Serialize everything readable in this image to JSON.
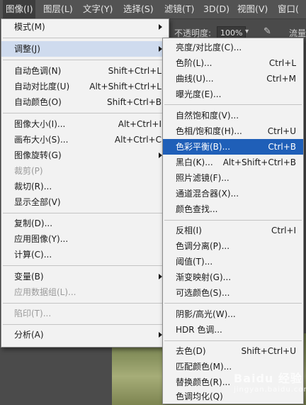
{
  "menubar": {
    "items": [
      {
        "label": "图像(I)"
      },
      {
        "label": "图层(L)"
      },
      {
        "label": "文字(Y)"
      },
      {
        "label": "选择(S)"
      },
      {
        "label": "滤镜(T)"
      },
      {
        "label": "3D(D)"
      },
      {
        "label": "视图(V)"
      },
      {
        "label": "窗口("
      }
    ]
  },
  "options_bar": {
    "opacity_label": "不透明度:",
    "opacity_value": "100%",
    "flow_label": "流量"
  },
  "image_menu": {
    "items": [
      {
        "label": "模式(M)",
        "submenu": true
      },
      {
        "label": "调整(J)",
        "submenu": true,
        "highlight": true
      },
      {
        "label": "自动色调(N)",
        "shortcut": "Shift+Ctrl+L"
      },
      {
        "label": "自动对比度(U)",
        "shortcut": "Alt+Shift+Ctrl+L"
      },
      {
        "label": "自动颜色(O)",
        "shortcut": "Shift+Ctrl+B"
      },
      {
        "label": "图像大小(I)...",
        "shortcut": "Alt+Ctrl+I"
      },
      {
        "label": "画布大小(S)...",
        "shortcut": "Alt+Ctrl+C"
      },
      {
        "label": "图像旋转(G)",
        "submenu": true
      },
      {
        "label": "裁剪(P)",
        "disabled": true
      },
      {
        "label": "裁切(R)..."
      },
      {
        "label": "显示全部(V)"
      },
      {
        "label": "复制(D)..."
      },
      {
        "label": "应用图像(Y)..."
      },
      {
        "label": "计算(C)..."
      },
      {
        "label": "变量(B)",
        "submenu": true
      },
      {
        "label": "应用数据组(L)...",
        "disabled": true
      },
      {
        "label": "陷印(T)...",
        "disabled": true
      },
      {
        "label": "分析(A)",
        "submenu": true
      }
    ]
  },
  "adjust_menu": {
    "items": [
      {
        "label": "亮度/对比度(C)..."
      },
      {
        "label": "色阶(L)...",
        "shortcut": "Ctrl+L"
      },
      {
        "label": "曲线(U)...",
        "shortcut": "Ctrl+M"
      },
      {
        "label": "曝光度(E)..."
      },
      {
        "label": "自然饱和度(V)..."
      },
      {
        "label": "色相/饱和度(H)...",
        "shortcut": "Ctrl+U"
      },
      {
        "label": "色彩平衡(B)...",
        "shortcut": "Ctrl+B",
        "highlight": true
      },
      {
        "label": "黑白(K)...",
        "shortcut": "Alt+Shift+Ctrl+B"
      },
      {
        "label": "照片滤镜(F)..."
      },
      {
        "label": "通道混合器(X)..."
      },
      {
        "label": "颜色查找..."
      },
      {
        "label": "反相(I)",
        "shortcut": "Ctrl+I"
      },
      {
        "label": "色调分离(P)..."
      },
      {
        "label": "阈值(T)..."
      },
      {
        "label": "渐变映射(G)..."
      },
      {
        "label": "可选颜色(S)..."
      },
      {
        "label": "阴影/高光(W)..."
      },
      {
        "label": "HDR 色调..."
      },
      {
        "label": "去色(D)",
        "shortcut": "Shift+Ctrl+U"
      },
      {
        "label": "匹配颜色(M)..."
      },
      {
        "label": "替换颜色(R)..."
      },
      {
        "label": "色调均化(Q)"
      }
    ]
  },
  "watermark": {
    "text": "Baidu 经验",
    "sub": "jingyan.baidu.com"
  }
}
